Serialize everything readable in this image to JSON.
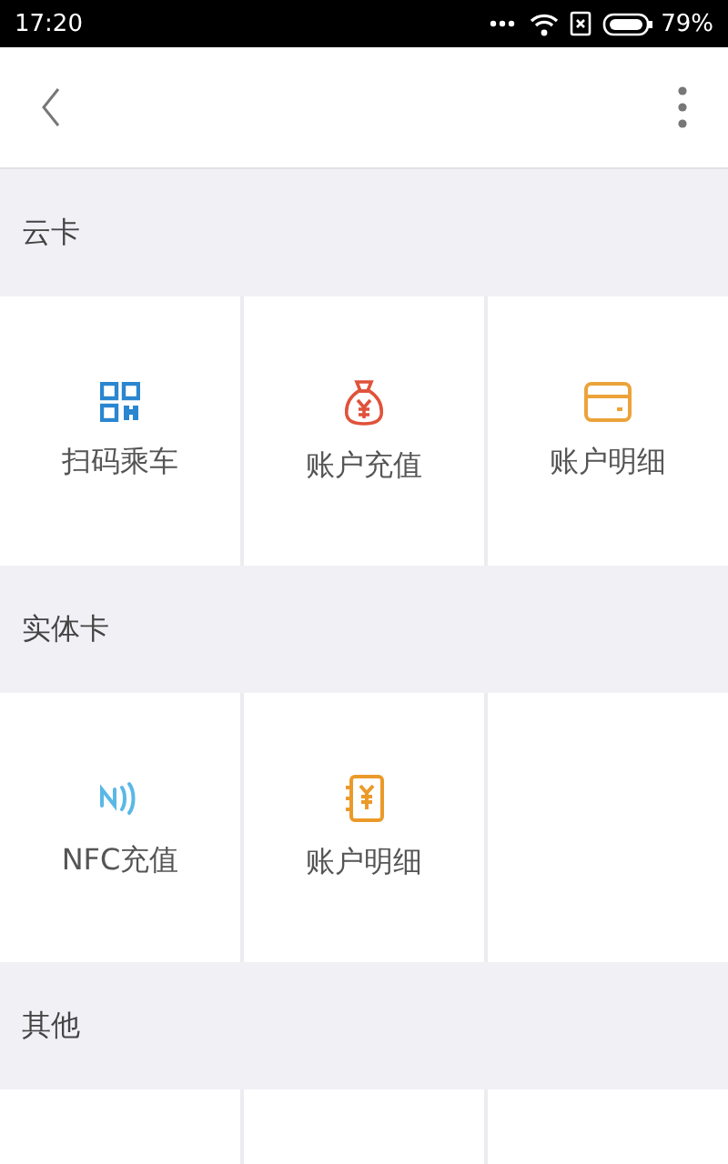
{
  "status_bar": {
    "time": "17:20",
    "battery": "79%"
  },
  "sections": [
    {
      "title": "云卡",
      "tiles": [
        {
          "kind": "qr",
          "label": "扫码乘车"
        },
        {
          "kind": "moneybag",
          "label": "账户充值"
        },
        {
          "kind": "card",
          "label": "账户明细"
        }
      ]
    },
    {
      "title": "实体卡",
      "tiles": [
        {
          "kind": "nfc",
          "label": "NFC充值"
        },
        {
          "kind": "ledger",
          "label": "账户明细"
        }
      ]
    },
    {
      "title": "其他"
    }
  ]
}
